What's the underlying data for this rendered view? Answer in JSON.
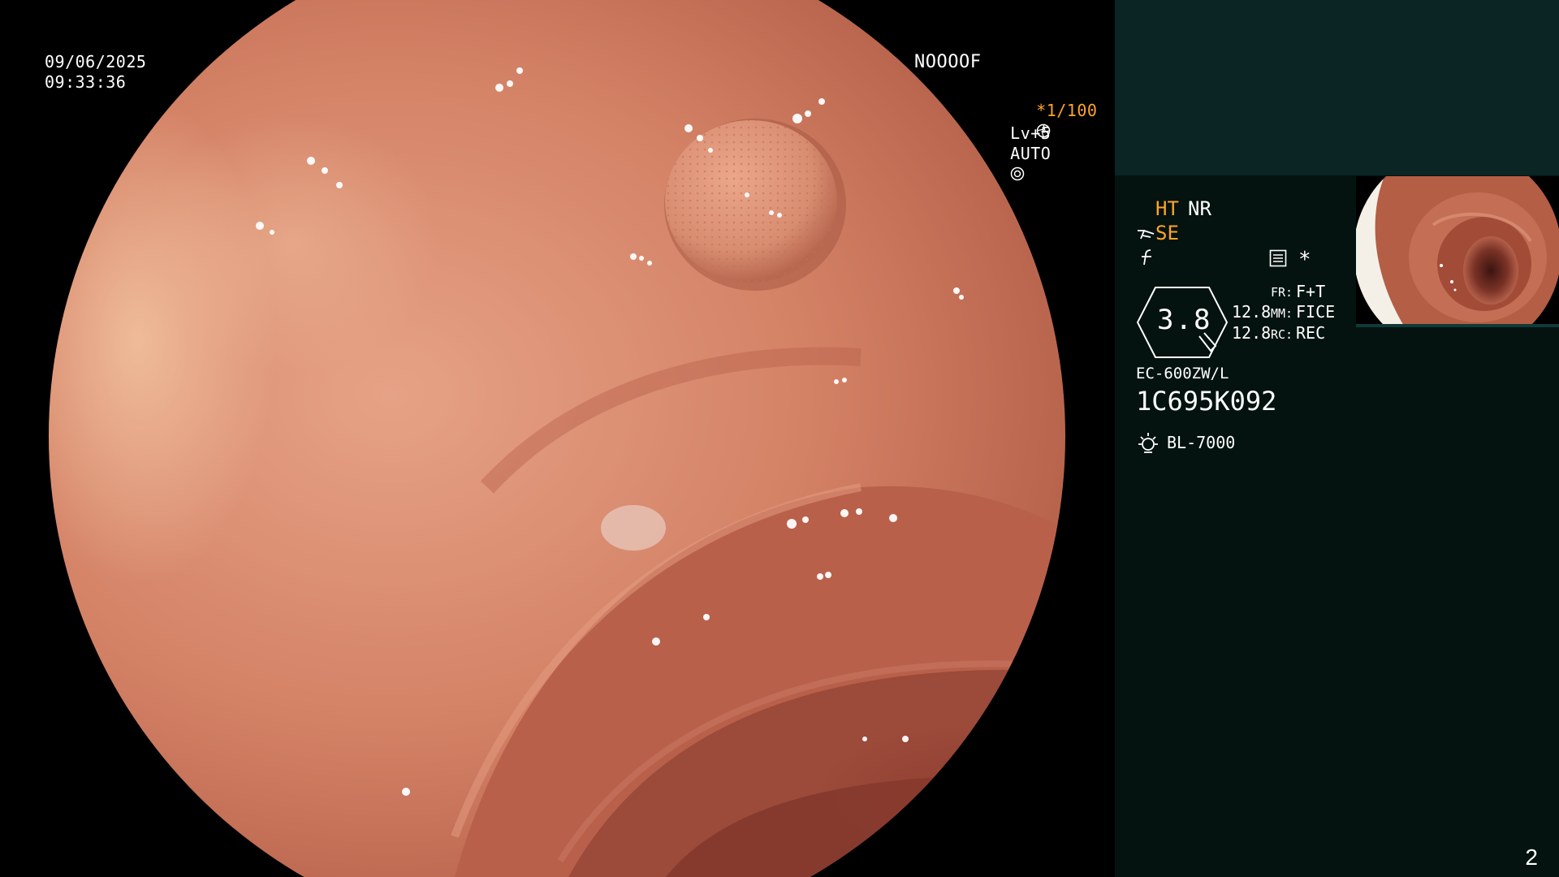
{
  "overlay": {
    "date": "09/06/2025",
    "time": "09:33:36",
    "patient_code": "NOOOOF",
    "shutter": "*1/100",
    "level": "Lv+5",
    "mode": "AUTO"
  },
  "panel": {
    "ht_label": "HT",
    "nr_label": "NR",
    "se_label": "SE",
    "star": "*",
    "zoom_value": "3.8",
    "value_1": "12.8",
    "value_2": "12.8",
    "fr_label": "FR:",
    "fr_value": "F+T",
    "mm_label": "MM:",
    "mm_value": "FICE",
    "rc_label": "RC:",
    "rc_value": "REC",
    "scope_model": "EC-600ZW/L",
    "serial": "1C695K092",
    "light_source": "BL-7000",
    "page_number": "2"
  },
  "colors": {
    "overlay_orange": "#ffa428",
    "panel_bg": "#04130f",
    "panel_top_band": "#0a2523",
    "mucosa": "#d98a72"
  },
  "icons": {
    "shutter_suffix": "aperture-icon",
    "mode_suffix": "iris-icon",
    "se_prefix": "scope-tip-icon",
    "f_symbol": "freeze-icon",
    "menu": "menu-list-icon",
    "light": "lamp-icon"
  }
}
